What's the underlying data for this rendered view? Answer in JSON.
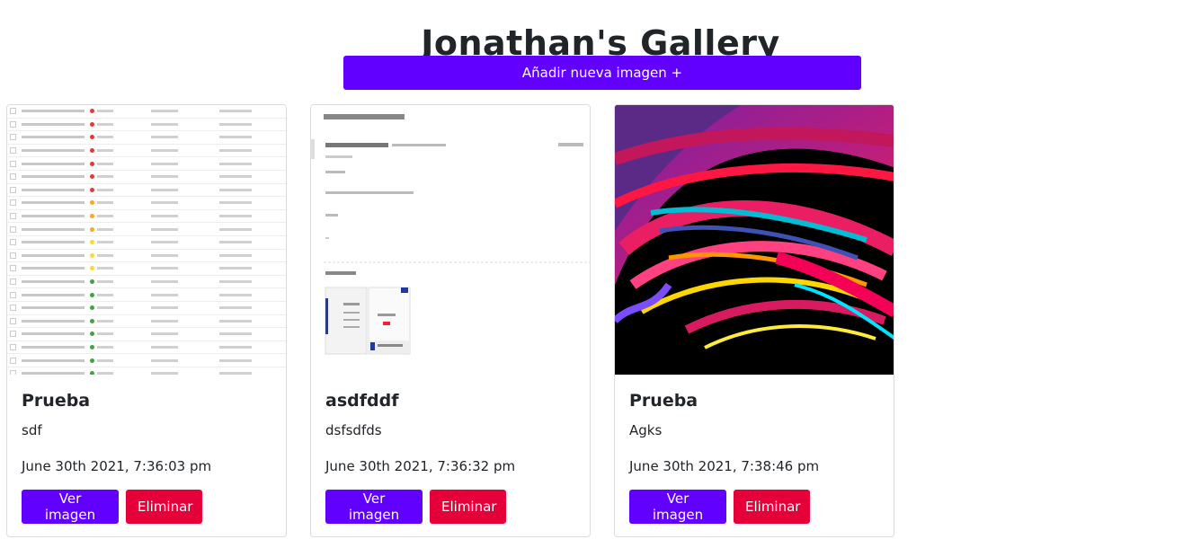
{
  "page": {
    "title": "Jonathan's Gallery",
    "add_button": "Añadir nueva imagen +"
  },
  "cards": [
    {
      "title": "Prueba",
      "description": "sdf",
      "date": "June 30th 2021, 7:36:03 pm",
      "view_label": "Ver imagen",
      "delete_label": "Eliminar",
      "thumbnail": "network-device-table-screenshot"
    },
    {
      "title": "asdfddf",
      "description": "dsfsdfds",
      "date": "June 30th 2021, 7:36:32 pm",
      "view_label": "Ver imagen",
      "delete_label": "Eliminar",
      "thumbnail": "email-screenshot"
    },
    {
      "title": "Prueba",
      "description": "Agks",
      "date": "June 30th 2021, 7:38:46 pm",
      "view_label": "Ver imagen",
      "delete_label": "Eliminar",
      "thumbnail": "abstract-colorful-swirl-art"
    }
  ],
  "colors": {
    "primary": "#6200ff",
    "danger": "#e5003a",
    "text": "#212529",
    "border": "#dcdcdc"
  }
}
